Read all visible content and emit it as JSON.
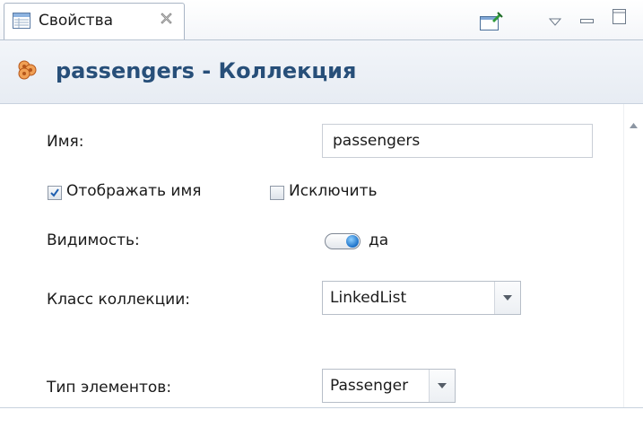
{
  "tab": {
    "label": "Свойства",
    "close_icon": "close-icon"
  },
  "toolbar": {
    "icons": [
      "pin-editor-icon",
      "view-menu-icon",
      "minimize-icon",
      "maximize-icon"
    ]
  },
  "header": {
    "title": "passengers - Коллекция",
    "icon": "collection-icon"
  },
  "form": {
    "name_label": "Имя:",
    "name_value": "passengers",
    "show_name_label": "Отображать имя",
    "show_name_checked": true,
    "exclude_label": "Исключить",
    "exclude_checked": false,
    "visibility_label": "Видимость:",
    "visibility_value": "да",
    "collection_class_label": "Класс коллекции:",
    "collection_class_value": "LinkedList",
    "element_type_label": "Тип элементов:",
    "element_type_value": "Passenger"
  },
  "colors": {
    "title": "#274f79",
    "accent": "#1a70c8"
  }
}
